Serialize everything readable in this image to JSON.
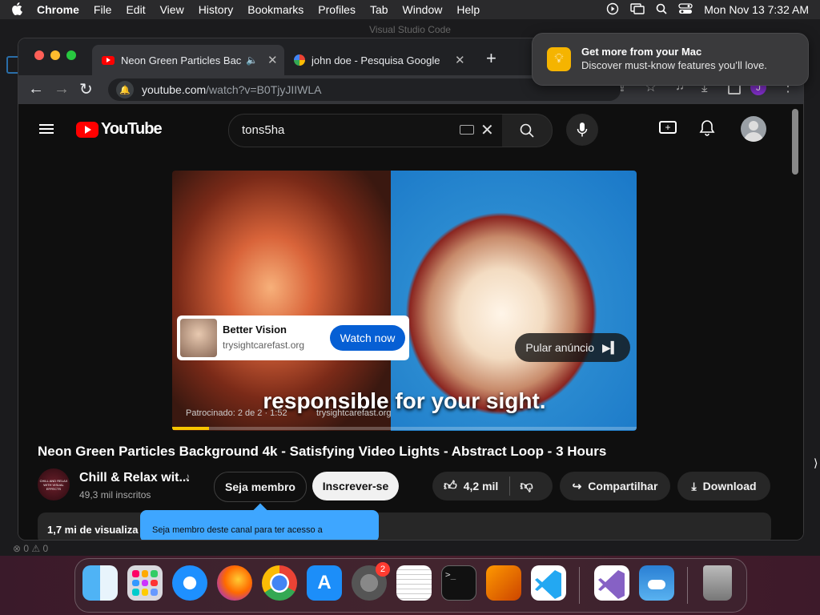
{
  "menubar": {
    "app": "Chrome",
    "items": [
      "File",
      "Edit",
      "View",
      "History",
      "Bookmarks",
      "Profiles",
      "Tab",
      "Window",
      "Help"
    ],
    "datetime": "Mon Nov 13  7:32 AM"
  },
  "background_window": {
    "title": "Visual Studio Code",
    "status": "⊗ 0 ⚠ 0"
  },
  "notification": {
    "title": "Get more from your Mac",
    "body": "Discover must-know features you’ll love."
  },
  "browser": {
    "tabs": [
      {
        "label": "Neon Green Particles Back",
        "active": true
      },
      {
        "label": "john doe - Pesquisa Google",
        "active": false
      }
    ],
    "url_host": "youtube.com",
    "url_path": "/watch?v=B0TjyJIIWLA",
    "profile_initial": "J"
  },
  "youtube": {
    "logo_text": "YouTube",
    "search_value": "tons5ha",
    "ad": {
      "advertiser": "Better Vision",
      "domain": "trysightcarefast.org",
      "cta": "Watch now",
      "skip": "Pular anúncio",
      "caption": "responsible for your sight.",
      "sponsor_line": "Patrocinado: 2 de 2 · 1:52",
      "sponsor_link": "trysightcarefast.org",
      "progress": 0.08
    },
    "video_title": "Neon Green Particles Background 4k - Satisfying Video Lights - Abstract Loop - 3 Hours",
    "channel": {
      "name": "Chill & Relax wit...",
      "subs": "49,3 mil inscritos",
      "avatar_text": "CHILL AND RELAX WITH VISUAL EFFECTS"
    },
    "buttons": {
      "member": "Seja membro",
      "subscribe": "Inscrever-se",
      "likes": "4,2 mil",
      "share": "Compartilhar",
      "download": "Download"
    },
    "views": "1,7 mi de visualiza",
    "tooltip": "Seja membro deste canal para ter acesso a"
  },
  "dock": {
    "items": [
      "Finder",
      "Launchpad",
      "Safari",
      "Firefox",
      "Chrome",
      "App Store",
      "System Settings",
      "TextEdit",
      "Terminal",
      "GarageBand",
      "Visual Studio Code",
      "Visual Studio",
      "Weather",
      "Trash"
    ],
    "badge": "2"
  },
  "colors": {
    "yt_red": "#ff0000",
    "ad_blue": "#065fd4",
    "progress_yellow": "#f9c500"
  }
}
